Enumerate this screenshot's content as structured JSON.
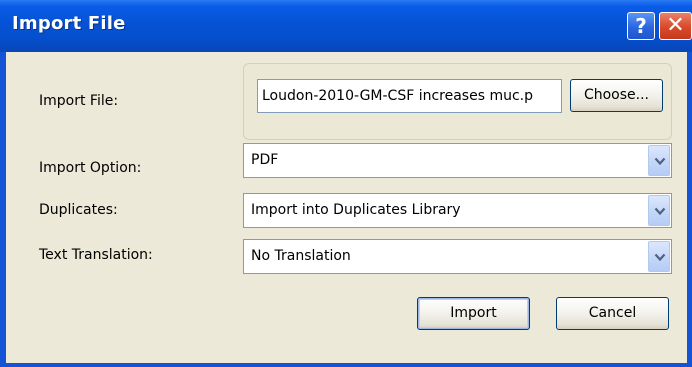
{
  "window": {
    "title": "Import File",
    "help_glyph": "?",
    "close_glyph": "✕"
  },
  "form": {
    "import_file": {
      "label": "Import File:",
      "value": "Loudon-2010-GM-CSF increases muc.p",
      "choose_label": "Choose..."
    },
    "import_option": {
      "label": "Import Option:",
      "value": "PDF"
    },
    "duplicates": {
      "label": "Duplicates:",
      "value": "Import into Duplicates Library"
    },
    "text_translation": {
      "label": "Text Translation:",
      "value": "No Translation"
    }
  },
  "buttons": {
    "import_label": "Import",
    "cancel_label": "Cancel"
  },
  "icons": {
    "help": "help-icon",
    "close": "close-icon",
    "dropdown": "chevron-down-icon"
  },
  "colors": {
    "titlebar": "#0652d4",
    "dialog_background": "#ece9d8",
    "close_button": "#d9492a"
  }
}
